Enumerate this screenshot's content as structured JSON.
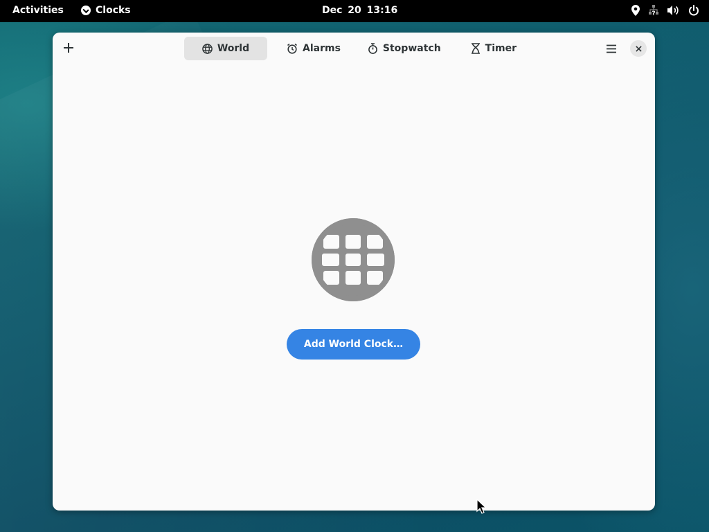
{
  "topbar": {
    "activities_label": "Activities",
    "app_name": "Clocks",
    "datetime": "Dec 20  13:16",
    "tray_icons": [
      "location-icon",
      "network-unknown-icon",
      "volume-icon",
      "power-icon"
    ]
  },
  "window": {
    "tabs": [
      {
        "label": "World",
        "icon": "globe-icon",
        "active": true
      },
      {
        "label": "Alarms",
        "icon": "alarm-icon",
        "active": false
      },
      {
        "label": "Stopwatch",
        "icon": "stopwatch-icon",
        "active": false
      },
      {
        "label": "Timer",
        "icon": "hourglass-icon",
        "active": false
      }
    ],
    "empty_state": {
      "button_label": "Add World Clock…"
    }
  },
  "colors": {
    "accent": "#3584e4",
    "active_tab_bg": "#e3e3e3",
    "globe": "#8f8f8f"
  }
}
